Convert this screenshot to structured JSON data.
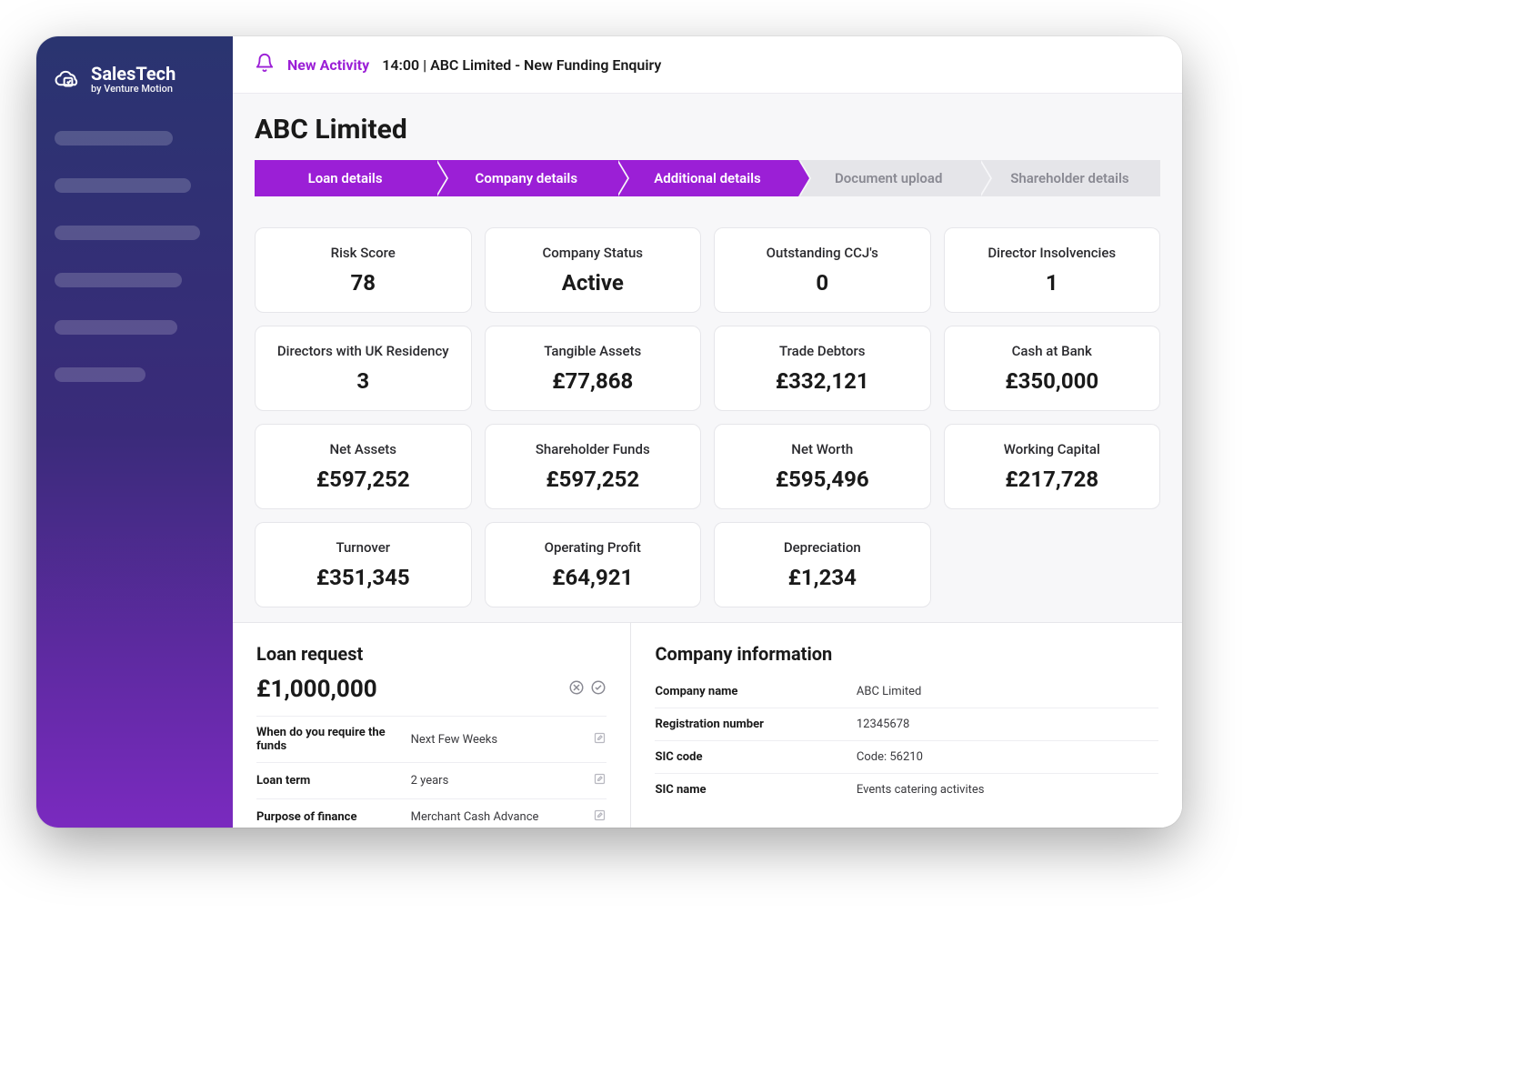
{
  "brand": {
    "name": "SalesTech",
    "tagline": "by Venture Motion"
  },
  "notification": {
    "label": "New Activity",
    "text": "14:00 | ABC Limited - New Funding Enquiry"
  },
  "page": {
    "title": "ABC Limited"
  },
  "steps": [
    {
      "label": "Loan details",
      "active": true
    },
    {
      "label": "Company details",
      "active": true
    },
    {
      "label": "Additional details",
      "active": true
    },
    {
      "label": "Document upload",
      "active": false
    },
    {
      "label": "Shareholder details",
      "active": false
    }
  ],
  "metrics": [
    {
      "label": "Risk Score",
      "value": "78"
    },
    {
      "label": "Company Status",
      "value": "Active"
    },
    {
      "label": "Outstanding CCJ's",
      "value": "0"
    },
    {
      "label": "Director Insolvencies",
      "value": "1"
    },
    {
      "label": "Directors with UK Residency",
      "value": "3"
    },
    {
      "label": "Tangible Assets",
      "value": "£77,868"
    },
    {
      "label": "Trade Debtors",
      "value": "£332,121"
    },
    {
      "label": "Cash at Bank",
      "value": "£350,000"
    },
    {
      "label": "Net Assets",
      "value": "£597,252"
    },
    {
      "label": "Shareholder Funds",
      "value": "£597,252"
    },
    {
      "label": "Net Worth",
      "value": "£595,496"
    },
    {
      "label": "Working Capital",
      "value": "£217,728"
    },
    {
      "label": "Turnover",
      "value": "£351,345"
    },
    {
      "label": "Operating Profit",
      "value": "£64,921"
    },
    {
      "label": "Depreciation",
      "value": "£1,234"
    }
  ],
  "loan_request": {
    "title": "Loan request",
    "amount": "£1,000,000",
    "rows": [
      {
        "label": "When do you require the funds",
        "value": "Next Few Weeks"
      },
      {
        "label": "Loan term",
        "value": "2 years"
      },
      {
        "label": "Purpose of finance",
        "value": "Merchant Cash Advance"
      }
    ]
  },
  "company_info": {
    "title": "Company information",
    "rows": [
      {
        "label": "Company name",
        "value": "ABC Limited"
      },
      {
        "label": "Registration number",
        "value": "12345678"
      },
      {
        "label": "SIC code",
        "value": "Code: 56210"
      },
      {
        "label": "SIC name",
        "value": "Events catering activites"
      }
    ]
  }
}
